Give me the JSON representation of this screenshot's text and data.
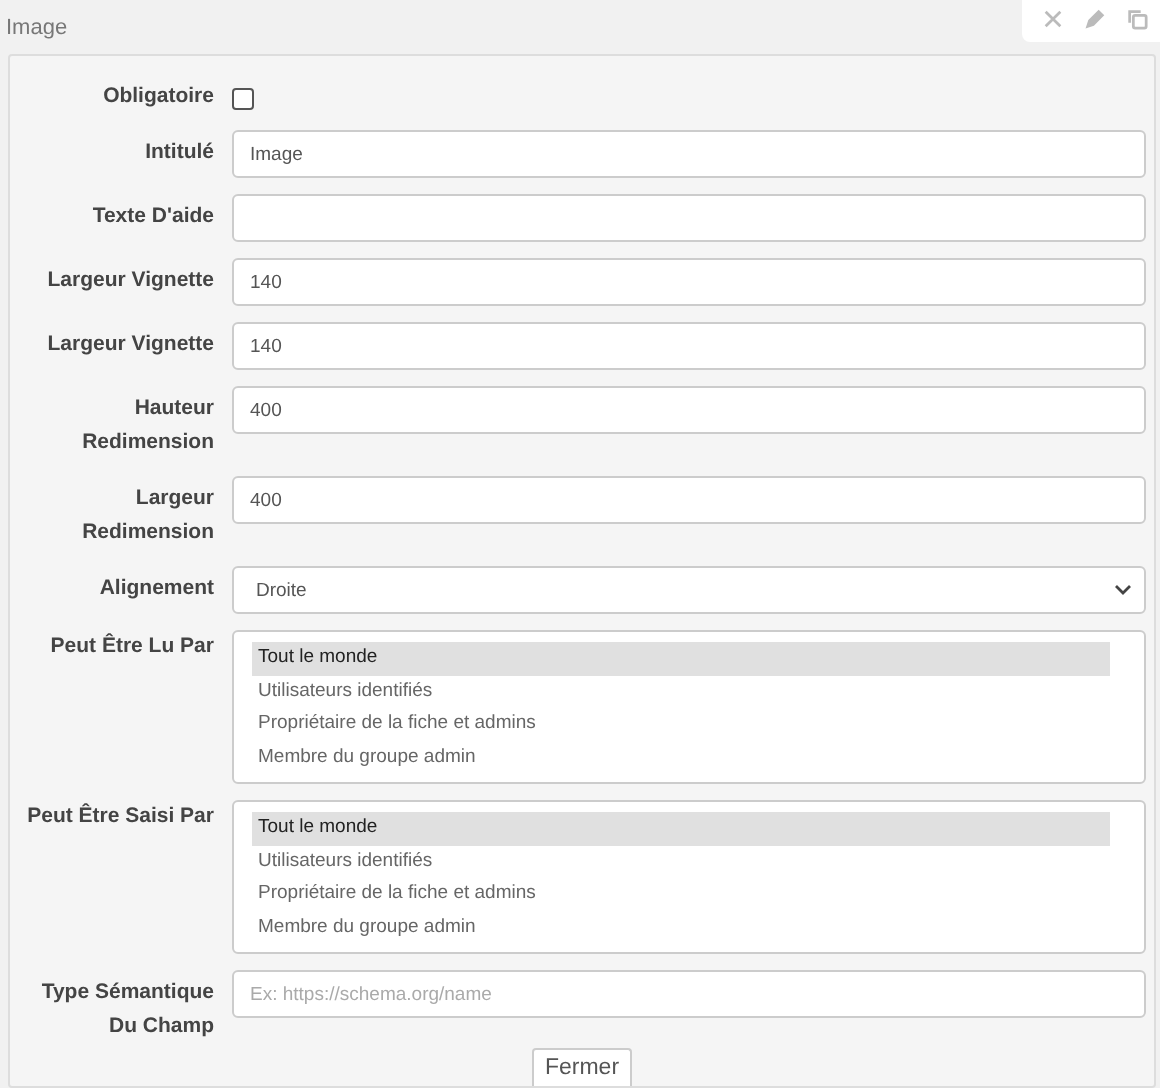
{
  "panel": {
    "title": "Image"
  },
  "fields": [
    {
      "kind": "checkbox",
      "label": "Obligatoire",
      "checked": false
    },
    {
      "kind": "text",
      "label": "Intitulé",
      "value": "Image"
    },
    {
      "kind": "text",
      "label": "Texte D'aide"
    },
    {
      "kind": "text",
      "label": "Largeur Vignette",
      "value": "140"
    },
    {
      "kind": "text",
      "label": "Largeur Vignette",
      "value": "140"
    },
    {
      "kind": "text",
      "label": "Hauteur Redimension",
      "value": "400"
    },
    {
      "kind": "text",
      "label": "Largeur Redimension",
      "value": "400"
    },
    {
      "kind": "select",
      "label": "Alignement",
      "value": "Droite"
    },
    {
      "kind": "listbox",
      "label": "Peut Être Lu Par",
      "options": [
        {
          "label": "Tout le monde",
          "selected": true
        },
        {
          "label": "Utilisateurs identifiés",
          "selected": false
        },
        {
          "label": "Propriétaire de la fiche et admins",
          "selected": false
        },
        {
          "label": "Membre du groupe admin",
          "selected": false
        }
      ]
    },
    {
      "kind": "listbox",
      "label": "Peut Être Saisi Par",
      "options": [
        {
          "label": "Tout le monde",
          "selected": true
        },
        {
          "label": "Utilisateurs identifiés",
          "selected": false
        },
        {
          "label": "Propriétaire de la fiche et admins",
          "selected": false
        },
        {
          "label": "Membre du groupe admin",
          "selected": false
        }
      ]
    },
    {
      "kind": "text",
      "label": "Type Sémantique Du Champ",
      "placeholder": "Ex: https://schema.org/name"
    }
  ],
  "close_button": "Fermer"
}
